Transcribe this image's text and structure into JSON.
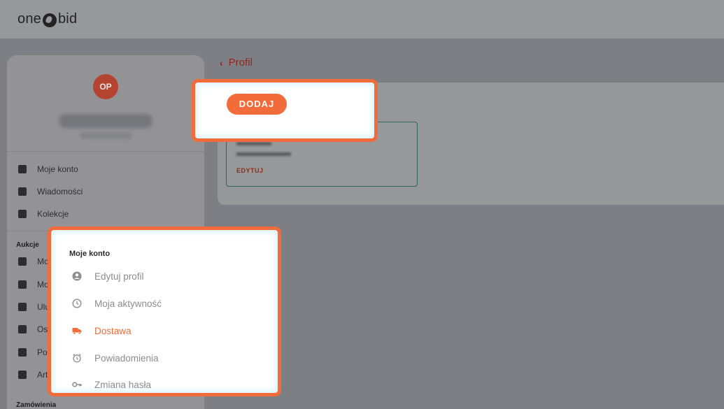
{
  "header": {
    "logo_left": "one",
    "logo_right": "bid"
  },
  "sidebar": {
    "avatar_initials": "OP",
    "items": [
      {
        "label": "Moje konto",
        "icon": "dashboard-icon"
      },
      {
        "label": "Wiadomości",
        "icon": "message-icon"
      },
      {
        "label": "Kolekcje",
        "icon": "collection-icon"
      }
    ],
    "section_auctions": "Aukcje",
    "auction_items": [
      {
        "label": "Mo",
        "icon": "gavel-icon"
      },
      {
        "label": "Mo",
        "icon": "basket-icon"
      },
      {
        "label": "Ulu",
        "icon": "star-icon"
      },
      {
        "label": "Ost",
        "icon": "history-icon"
      },
      {
        "label": "Pos",
        "icon": "search-icon"
      },
      {
        "label": "Art",
        "icon": "heart-icon"
      }
    ],
    "section_orders": "Zamówienia"
  },
  "main": {
    "back_label": "Profil",
    "add_button": "DODAJ",
    "address_card": {
      "edit_label": "EDYTUJ"
    }
  },
  "dropdown_menu": {
    "title": "Moje konto",
    "items": [
      {
        "label": "Edytuj profil",
        "icon": "account-circle-icon",
        "active": false
      },
      {
        "label": "Moja aktywność",
        "icon": "clock-icon",
        "active": false
      },
      {
        "label": "Dostawa",
        "icon": "truck-icon",
        "active": true
      },
      {
        "label": "Powiadomienia",
        "icon": "alarm-icon",
        "active": false
      },
      {
        "label": "Zmiana hasła",
        "icon": "key-icon",
        "active": false
      }
    ]
  },
  "colors": {
    "accent": "#f26b3a",
    "highlight_border": "#f26b3a",
    "card_border": "#2d6b58"
  }
}
